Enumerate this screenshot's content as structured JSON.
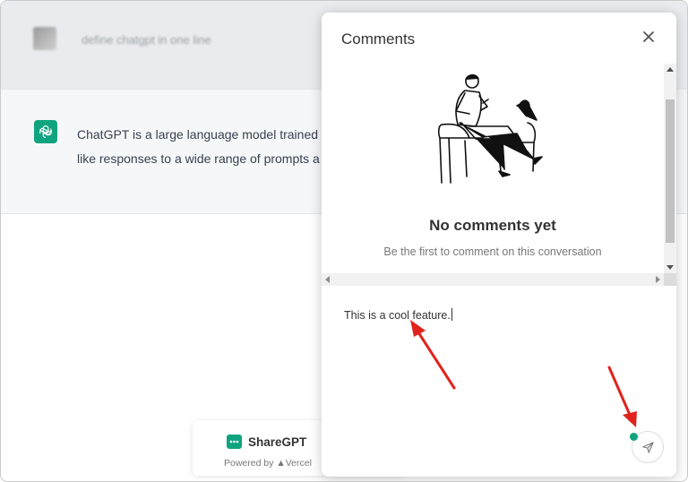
{
  "conversation": {
    "question": "define chatgpt in one line",
    "answer_lines": [
      "ChatGPT is a large language model trained o",
      "like responses to a wide range of prompts a"
    ]
  },
  "sharegpt": {
    "name": "ShareGPT",
    "powered_by": "Powered by ▲Vercel"
  },
  "comments_panel": {
    "title": "Comments",
    "empty_title": "No comments yet",
    "empty_subtitle": "Be the first to comment on this conversation",
    "input_value": "This is a cool feature."
  },
  "colors": {
    "accent": "#10a37f",
    "arrow": "#e0231c"
  },
  "icons": {
    "close": "close-icon",
    "send": "send-icon",
    "chatgpt": "chatgpt-logo-icon",
    "sharegpt": "chat-bubble-icon"
  }
}
